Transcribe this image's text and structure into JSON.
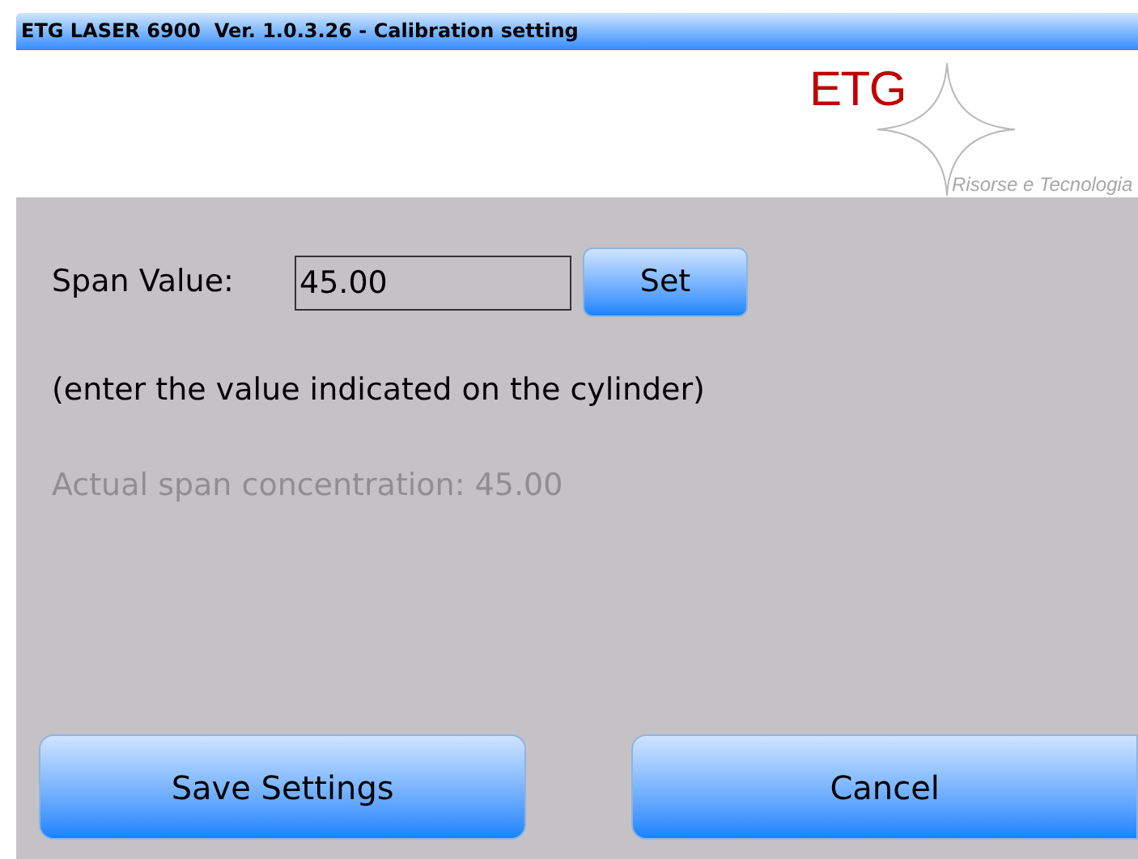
{
  "window": {
    "title": "ETG LASER 6900  Ver. 1.0.3.26 - Calibration setting"
  },
  "logo": {
    "name": "ETG",
    "tagline": "Risorse e Tecnologia"
  },
  "span": {
    "label": "Span Value:",
    "value": "45.00",
    "button": "Set"
  },
  "hint": "(enter the value indicated on the cylinder)",
  "actual": {
    "text": "Actual span concentration: 45.00",
    "disabled": true
  },
  "buttons": [
    "Save Settings",
    "Cancel"
  ]
}
